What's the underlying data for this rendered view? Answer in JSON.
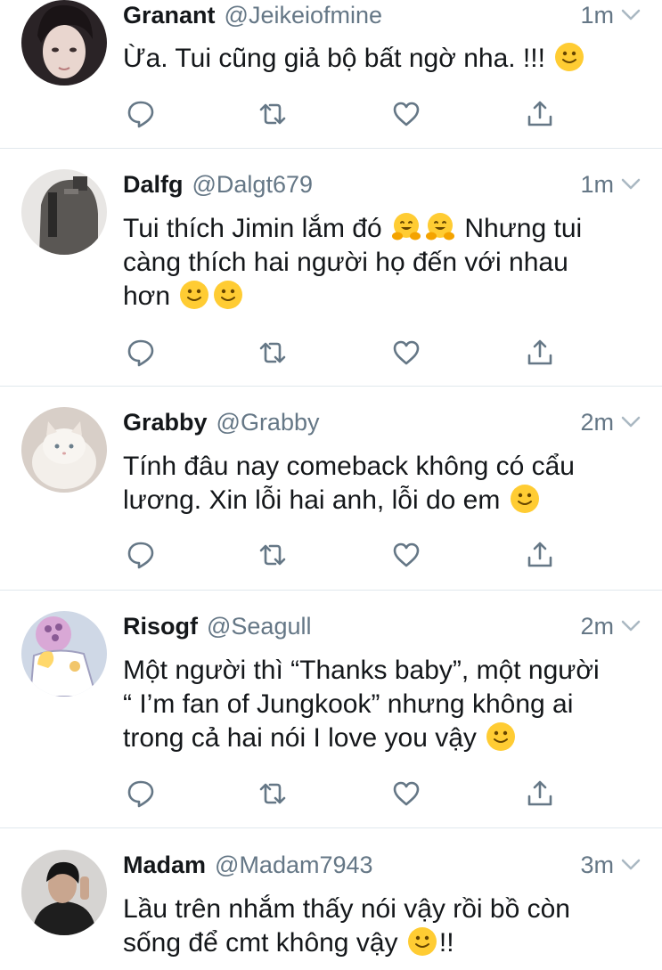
{
  "tweets": [
    {
      "name": "Granant",
      "handle": "@Jeikeiofmine",
      "time": "1m",
      "lines": [
        "Ừa. Tui cũng giả bộ bất ngờ nha. !!!"
      ],
      "avatar": "dark-haired-person-avatar"
    },
    {
      "name": "Dalfg",
      "handle": "@Dalgt679",
      "time": "1m",
      "lines": [
        "Tui thích Jimin lắm đó",
        "Nhưng tui",
        "càng thích hai người họ đến với nhau",
        "hơn"
      ],
      "avatar": "backpack-avatar"
    },
    {
      "name": "Grabby",
      "handle": "@Grabby",
      "time": "2m",
      "lines": [
        "Tính đâu nay comeback không có cẩu",
        "lương. Xin lỗi hai anh, lỗi do em"
      ],
      "avatar": "white-cat-avatar"
    },
    {
      "name": "Risogf",
      "handle": "@Seagull",
      "time": "2m",
      "lines": [
        "Một người thì “Thanks baby”, một người",
        "“ I’m fan of Jungkook” nhưng không ai",
        "trong cả hai nói I love you vậy"
      ],
      "avatar": "cartoon-avatar"
    },
    {
      "name": "Madam",
      "handle": "@Madam7943",
      "time": "3m",
      "lines": [
        "Lầu trên nhắm thấy nói vậy rồi bồ còn",
        "sống để cmt không vậy",
        "!!"
      ],
      "avatar": "person-dark-avatar"
    }
  ],
  "colors": {
    "secondary_text": "#657786",
    "icon": "#657786",
    "divider": "#e1e8ed",
    "emoji_face": "#ffcc33"
  },
  "icons": [
    "reply-icon",
    "retweet-icon",
    "like-icon",
    "share-icon",
    "chevron-down-icon",
    "smiling-emoji",
    "hugging-emoji"
  ]
}
